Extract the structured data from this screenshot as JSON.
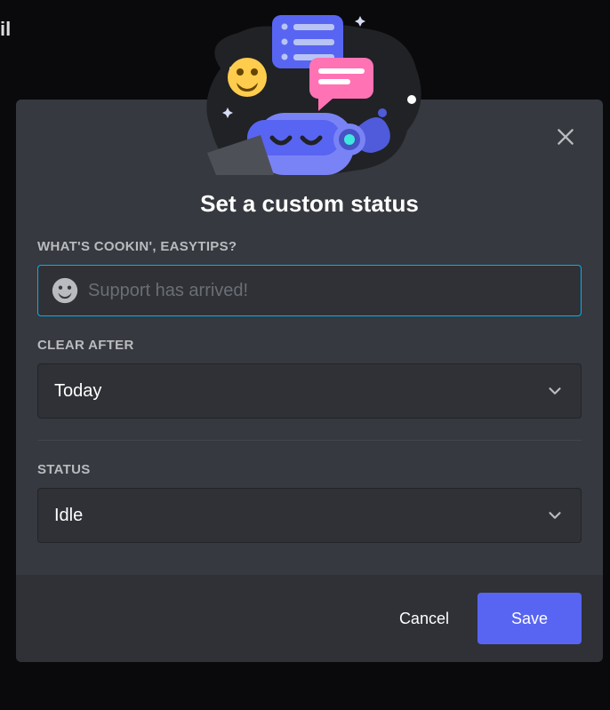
{
  "modal": {
    "title": "Set a custom status",
    "close_icon": "close"
  },
  "fields": {
    "status_text": {
      "label": "WHAT'S COOKIN', EASYTIPS?",
      "placeholder": "Support has arrived!",
      "value": "",
      "emoji_icon": "grinning-face"
    },
    "clear_after": {
      "label": "CLEAR AFTER",
      "value": "Today"
    },
    "status": {
      "label": "STATUS",
      "value": "Idle"
    }
  },
  "footer": {
    "cancel_label": "Cancel",
    "save_label": "Save"
  }
}
